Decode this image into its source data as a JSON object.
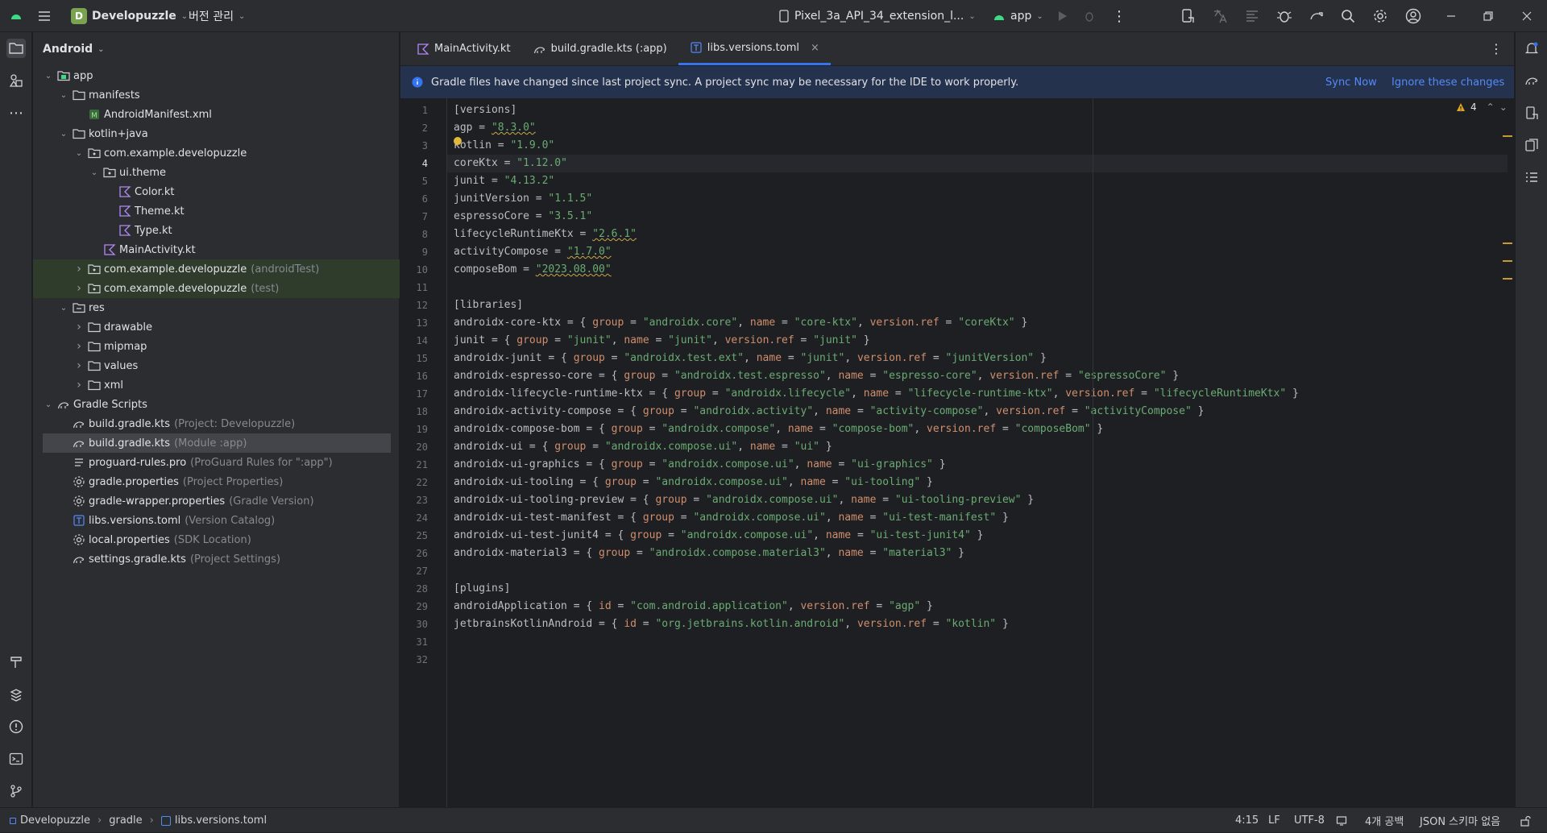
{
  "titlebar": {
    "project_badge": "D",
    "project_name": "Developuzzle",
    "vcs_label": "버전 관리",
    "device": "Pixel_3a_API_34_extension_l...",
    "run_config": "app"
  },
  "project_panel": {
    "view_label": "Android",
    "tree": [
      {
        "label": "app",
        "hint": "",
        "depth": 0,
        "arrow": "down",
        "icon": "module-icon"
      },
      {
        "label": "manifests",
        "hint": "",
        "depth": 1,
        "arrow": "down",
        "icon": "folder-icon"
      },
      {
        "label": "AndroidManifest.xml",
        "hint": "",
        "depth": 2,
        "arrow": "none",
        "icon": "manifest-icon"
      },
      {
        "label": "kotlin+java",
        "hint": "",
        "depth": 1,
        "arrow": "down",
        "icon": "folder-icon"
      },
      {
        "label": "com.example.developuzzle",
        "hint": "",
        "depth": 2,
        "arrow": "down",
        "icon": "package-icon"
      },
      {
        "label": "ui.theme",
        "hint": "",
        "depth": 3,
        "arrow": "down",
        "icon": "package-icon"
      },
      {
        "label": "Color.kt",
        "hint": "",
        "depth": 4,
        "arrow": "none",
        "icon": "kotlin-file-icon"
      },
      {
        "label": "Theme.kt",
        "hint": "",
        "depth": 4,
        "arrow": "none",
        "icon": "kotlin-file-icon"
      },
      {
        "label": "Type.kt",
        "hint": "",
        "depth": 4,
        "arrow": "none",
        "icon": "kotlin-file-icon"
      },
      {
        "label": "MainActivity.kt",
        "hint": "",
        "depth": 3,
        "arrow": "none",
        "icon": "kotlin-file-icon"
      },
      {
        "label": "com.example.developuzzle",
        "hint": "(androidTest)",
        "depth": 2,
        "arrow": "right",
        "icon": "package-icon",
        "green": true
      },
      {
        "label": "com.example.developuzzle",
        "hint": "(test)",
        "depth": 2,
        "arrow": "right",
        "icon": "package-icon",
        "green": true
      },
      {
        "label": "res",
        "hint": "",
        "depth": 1,
        "arrow": "down",
        "icon": "res-folder-icon"
      },
      {
        "label": "drawable",
        "hint": "",
        "depth": 2,
        "arrow": "right",
        "icon": "folder-icon"
      },
      {
        "label": "mipmap",
        "hint": "",
        "depth": 2,
        "arrow": "right",
        "icon": "folder-icon"
      },
      {
        "label": "values",
        "hint": "",
        "depth": 2,
        "arrow": "right",
        "icon": "folder-icon"
      },
      {
        "label": "xml",
        "hint": "",
        "depth": 2,
        "arrow": "right",
        "icon": "folder-icon"
      },
      {
        "label": "Gradle Scripts",
        "hint": "",
        "depth": 0,
        "arrow": "down",
        "icon": "gradle-icon"
      },
      {
        "label": "build.gradle.kts",
        "hint": "(Project: Developuzzle)",
        "depth": 1,
        "arrow": "none",
        "icon": "gradle-icon"
      },
      {
        "label": "build.gradle.kts",
        "hint": "(Module :app)",
        "depth": 1,
        "arrow": "none",
        "icon": "gradle-icon",
        "selected": true
      },
      {
        "label": "proguard-rules.pro",
        "hint": "(ProGuard Rules for \":app\")",
        "depth": 1,
        "arrow": "none",
        "icon": "text-file-icon"
      },
      {
        "label": "gradle.properties",
        "hint": "(Project Properties)",
        "depth": 1,
        "arrow": "none",
        "icon": "settings-file-icon"
      },
      {
        "label": "gradle-wrapper.properties",
        "hint": "(Gradle Version)",
        "depth": 1,
        "arrow": "none",
        "icon": "settings-file-icon"
      },
      {
        "label": "libs.versions.toml",
        "hint": "(Version Catalog)",
        "depth": 1,
        "arrow": "none",
        "icon": "toml-file-icon"
      },
      {
        "label": "local.properties",
        "hint": "(SDK Location)",
        "depth": 1,
        "arrow": "none",
        "icon": "settings-file-icon"
      },
      {
        "label": "settings.gradle.kts",
        "hint": "(Project Settings)",
        "depth": 1,
        "arrow": "none",
        "icon": "gradle-icon"
      }
    ]
  },
  "editor": {
    "tabs": [
      {
        "label": "MainActivity.kt",
        "icon": "kotlin-file-icon",
        "active": false
      },
      {
        "label": "build.gradle.kts (:app)",
        "icon": "gradle-icon",
        "active": false
      },
      {
        "label": "libs.versions.toml",
        "icon": "toml-file-icon",
        "active": true
      }
    ],
    "notice": {
      "text": "Gradle files have changed since last project sync. A project sync may be necessary for the IDE to work properly.",
      "sync_now": "Sync Now",
      "ignore": "Ignore these changes"
    },
    "warning_count": "4",
    "current_line": 4,
    "lines": [
      "[versions]",
      "agp = \"8.3.0\"",
      "kotlin = \"1.9.0\"",
      "coreKtx = \"1.12.0\"",
      "junit = \"4.13.2\"",
      "junitVersion = \"1.1.5\"",
      "espressoCore = \"3.5.1\"",
      "lifecycleRuntimeKtx = \"2.6.1\"",
      "activityCompose = \"1.7.0\"",
      "composeBom = \"2023.08.00\"",
      "",
      "[libraries]",
      "androidx-core-ktx = { group = \"androidx.core\", name = \"core-ktx\", version.ref = \"coreKtx\" }",
      "junit = { group = \"junit\", name = \"junit\", version.ref = \"junit\" }",
      "androidx-junit = { group = \"androidx.test.ext\", name = \"junit\", version.ref = \"junitVersion\" }",
      "androidx-espresso-core = { group = \"androidx.test.espresso\", name = \"espresso-core\", version.ref = \"espressoCore\" }",
      "androidx-lifecycle-runtime-ktx = { group = \"androidx.lifecycle\", name = \"lifecycle-runtime-ktx\", version.ref = \"lifecycleRuntimeKtx\" }",
      "androidx-activity-compose = { group = \"androidx.activity\", name = \"activity-compose\", version.ref = \"activityCompose\" }",
      "androidx-compose-bom = { group = \"androidx.compose\", name = \"compose-bom\", version.ref = \"composeBom\" }",
      "androidx-ui = { group = \"androidx.compose.ui\", name = \"ui\" }",
      "androidx-ui-graphics = { group = \"androidx.compose.ui\", name = \"ui-graphics\" }",
      "androidx-ui-tooling = { group = \"androidx.compose.ui\", name = \"ui-tooling\" }",
      "androidx-ui-tooling-preview = { group = \"androidx.compose.ui\", name = \"ui-tooling-preview\" }",
      "androidx-ui-test-manifest = { group = \"androidx.compose.ui\", name = \"ui-test-manifest\" }",
      "androidx-ui-test-junit4 = { group = \"androidx.compose.ui\", name = \"ui-test-junit4\" }",
      "androidx-material3 = { group = \"androidx.compose.material3\", name = \"material3\" }",
      "",
      "[plugins]",
      "androidApplication = { id = \"com.android.application\", version.ref = \"agp\" }",
      "jetbrainsKotlinAndroid = { id = \"org.jetbrains.kotlin.android\", version.ref = \"kotlin\" }",
      "",
      ""
    ],
    "underlined_lines": [
      2,
      8,
      9,
      10
    ]
  },
  "statusbar": {
    "breadcrumb": [
      "Developuzzle",
      "gradle",
      "libs.versions.toml"
    ],
    "position": "4:15",
    "line_ending": "LF",
    "encoding": "UTF-8",
    "indent": "4개 공백",
    "schema": "JSON 스키마 없음"
  },
  "colors": {
    "accent": "#3574f0",
    "string": "#6aab73",
    "keyword": "#cf8e6d",
    "warning": "#e0a326"
  }
}
